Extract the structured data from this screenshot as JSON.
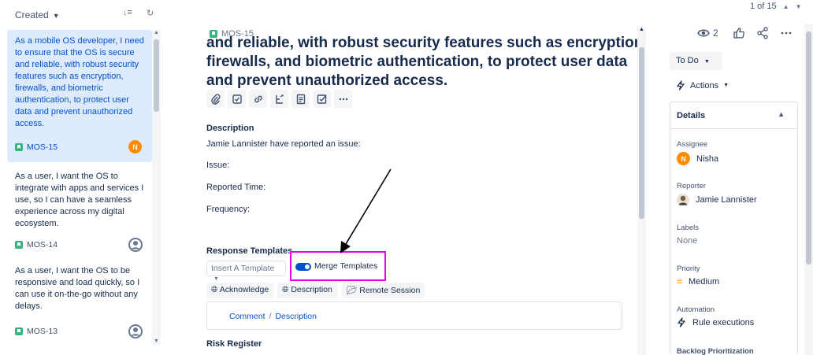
{
  "left_panel": {
    "sort_label": "Created",
    "cards": [
      {
        "text": "As a mobile OS developer, I need to ensure that the OS is secure and reliable, with robust security features such as encryption, firewalls, and biometric authentication, to protect user data and prevent unauthorized access.",
        "key": "MOS-15",
        "avatar": "N",
        "selected": true
      },
      {
        "text": "As a user, I want the OS to integrate with apps and services I use, so I can have a seamless experience across my digital ecosystem.",
        "key": "MOS-14",
        "avatar": "user-icon",
        "selected": false
      },
      {
        "text": "As a user, I want the OS to be responsive and load quickly, so I can use it on-the-go without any delays.",
        "key": "MOS-13",
        "avatar": "user-icon",
        "selected": false
      }
    ]
  },
  "issue": {
    "key": "MOS-15",
    "title_line1": "and reliable, with robust security features such as encryption,",
    "title_rest": "firewalls, and biometric authentication, to protect user data and prevent unauthorized access.",
    "description_label": "Description",
    "description_lines": [
      "Jamie Lannister have reported an issue:",
      "Issue:",
      "Reported Time:",
      "Frequency:"
    ],
    "response_templates_label": "Response Templates",
    "insert_template_placeholder": "Insert A Template",
    "merge_templates_label": "Merge Templates",
    "merge_templates_on": true,
    "chips": [
      "Acknowledge",
      "Description",
      "Remote Session"
    ],
    "comment_link": "Comment",
    "description_link": "Description",
    "risk_register_label": "Risk Register",
    "toolbar_icons": [
      "attachment-icon",
      "subtask-icon",
      "link-icon",
      "child-issue-icon",
      "page-icon",
      "checklist-icon",
      "more-icon"
    ]
  },
  "sidebar": {
    "pager": "1 of 15",
    "watchers_count": "2",
    "status": "To Do",
    "actions_label": "Actions",
    "details_label": "Details",
    "fields": {
      "assignee_label": "Assignee",
      "assignee_value": "Nisha",
      "assignee_avatar": "N",
      "reporter_label": "Reporter",
      "reporter_value": "Jamie Lannister",
      "labels_label": "Labels",
      "labels_value": "None",
      "priority_label": "Priority",
      "priority_value": "Medium",
      "automation_label": "Automation",
      "automation_value": "Rule executions",
      "backlog_label": "Backlog Prioritization"
    }
  },
  "colors": {
    "accent": "#0052CC",
    "selected_bg": "#DEEBFF",
    "highlight_box": "#E600E6",
    "story_green": "#36B37E",
    "avatar_orange": "#FF8B00"
  }
}
